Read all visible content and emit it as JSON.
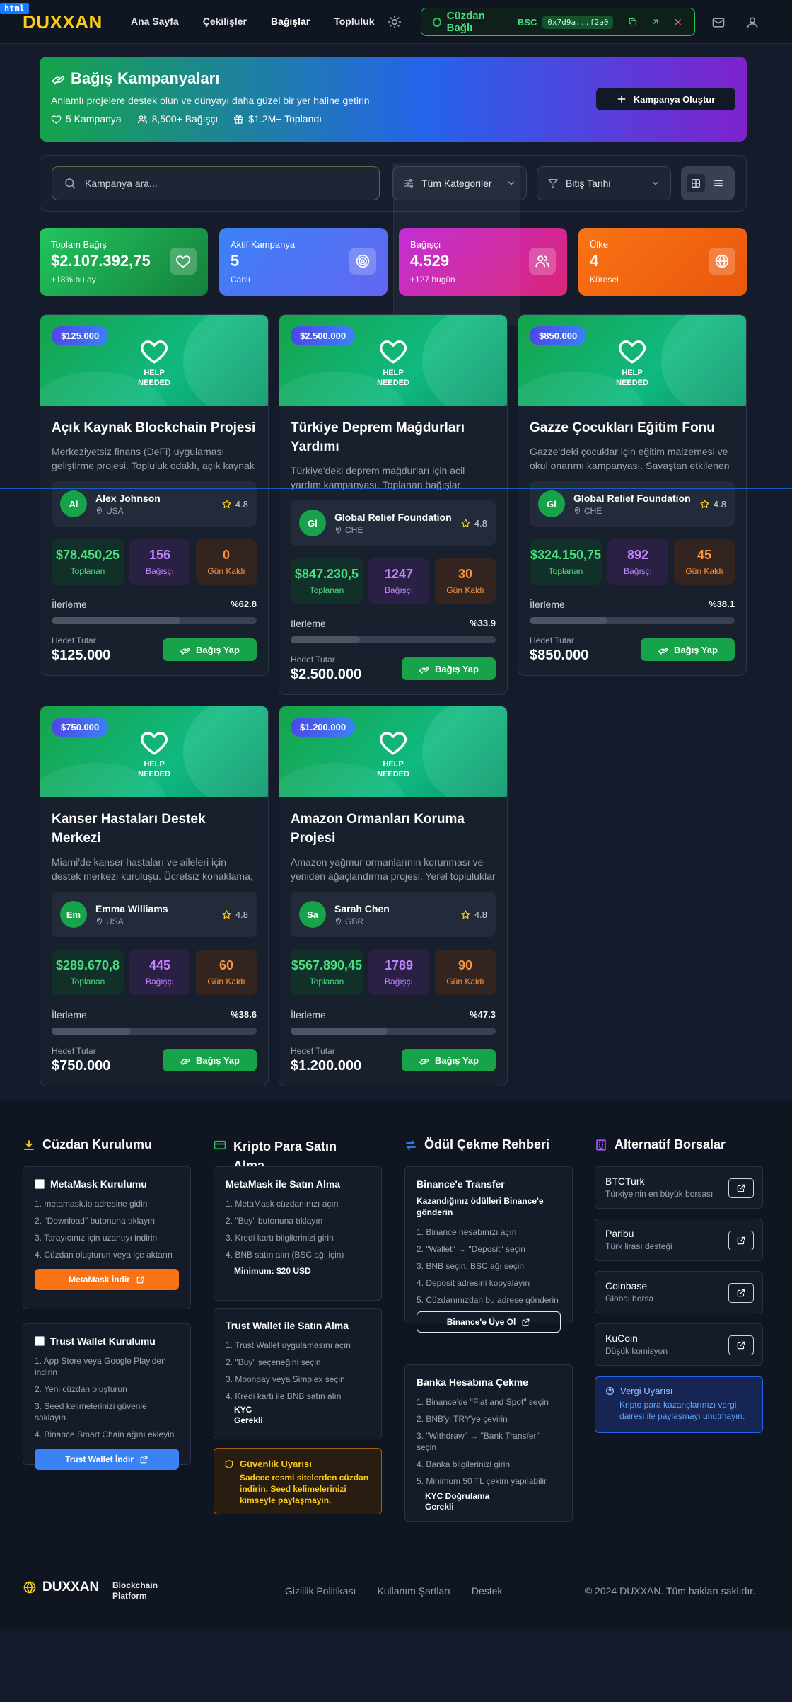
{
  "dev_tag": "html",
  "header": {
    "logo": "DUXXAN",
    "nav": [
      "Ana Sayfa",
      "Çekilişler",
      "Bağışlar",
      "Topluluk"
    ],
    "wallet": {
      "status": "Cüzdan Bağlı",
      "network": "BSC",
      "address": "0x7d9a...f2a0"
    }
  },
  "hero": {
    "title": "Bağış Kampanyaları",
    "subtitle": "Anlamlı projelere destek olun ve dünyayı daha güzel bir yer haline getirin",
    "stats": [
      "5 Kampanya",
      "8,500+ Bağışçı",
      "$1.2M+ Toplandı"
    ],
    "create_label": "Kampanya Oluştur"
  },
  "filters": {
    "search_placeholder": "Kampanya ara...",
    "category": "Tüm Kategoriler",
    "sort": "Bitiş Tarihi"
  },
  "stats": [
    {
      "label": "Toplam Bağış",
      "value": "$2.107.392,75",
      "sub": "+18% bu ay",
      "icon": "heart-icon",
      "color": "#22c55e"
    },
    {
      "label": "Aktif Kampanya",
      "value": "5",
      "sub": "Canlı",
      "icon": "target-icon",
      "color": "#3b82f6"
    },
    {
      "label": "Bağışçı",
      "value": "4.529",
      "sub": "+127 bugün",
      "icon": "users-icon",
      "color": "#c026d3"
    },
    {
      "label": "Ülke",
      "value": "4",
      "sub": "Küresel",
      "icon": "globe-icon",
      "color": "#f97316"
    }
  ],
  "card_labels": {
    "help": "HELP",
    "needed": "NEEDED",
    "raised": "Toplanan",
    "donors": "Bağışçı",
    "days_left": "Gün Kaldı",
    "progress": "İlerleme",
    "goal": "Hedef Tutar",
    "donate": "Bağış Yap"
  },
  "campaigns": [
    {
      "badge": "$125.000",
      "title": "Açık Kaynak Blockchain Projesi",
      "desc": "Merkeziyetsiz finans (DeFi) uygulaması geliştirme projesi. Topluluk odaklı, açık kaynak",
      "org": "Alex Johnson",
      "initials": "Al",
      "country": "USA",
      "rating": "4.8",
      "raised": "$78.450,25",
      "donors": "156",
      "days": "0",
      "progress_text": "%62.8",
      "progress": 0.628,
      "goal": "$125.000"
    },
    {
      "badge": "$2.500.000",
      "title": "Türkiye Deprem Mağdurları Yardımı",
      "desc": "Türkiye'deki deprem mağdurları için acil yardım kampanyası. Toplanan bağışlar",
      "org": "Global Relief Foundation",
      "initials": "Gl",
      "country": "CHE",
      "rating": "4.8",
      "raised": "$847.230,5",
      "donors": "1247",
      "days": "30",
      "progress_text": "%33.9",
      "progress": 0.339,
      "goal": "$2.500.000"
    },
    {
      "badge": "$850.000",
      "title": "Gazze Çocukları Eğitim Fonu",
      "desc": "Gazze'deki çocuklar için eğitim malzemesi ve okul onarımı kampanyası. Savaştan etkilenen",
      "org": "Global Relief Foundation",
      "initials": "Gl",
      "country": "CHE",
      "rating": "4.8",
      "raised": "$324.150,75",
      "donors": "892",
      "days": "45",
      "progress_text": "%38.1",
      "progress": 0.381,
      "goal": "$850.000"
    },
    {
      "badge": "$750.000",
      "title": "Kanser Hastaları Destek Merkezi",
      "desc": "Miami'de kanser hastaları ve aileleri için destek merkezi kuruluşu. Ücretsiz konaklama,",
      "org": "Emma Williams",
      "initials": "Em",
      "country": "USA",
      "rating": "4.8",
      "raised": "$289.670,8",
      "donors": "445",
      "days": "60",
      "progress_text": "%38.6",
      "progress": 0.386,
      "goal": "$750.000"
    },
    {
      "badge": "$1.200.000",
      "title": "Amazon Ormanları Koruma Projesi",
      "desc": "Amazon yağmur ormanlarının korunması ve yeniden ağaçlandırma projesi. Yerel topluluklar",
      "org": "Sarah Chen",
      "initials": "Sa",
      "country": "GBR",
      "rating": "4.8",
      "raised": "$567.890,45",
      "donors": "1789",
      "days": "90",
      "progress_text": "%47.3",
      "progress": 0.473,
      "goal": "$1.200.000"
    }
  ],
  "footer": {
    "wallet_setup": {
      "title": "Cüzdan Kurulumu",
      "metamask": {
        "title": "MetaMask Kurulumu",
        "steps": [
          "1. metamask.io adresine gidin",
          "2. \"Download\" butonuna tıklayın",
          "3. Tarayıcınız için uzantıyı indirin",
          "4. Cüzdan oluşturun veya içe aktarın"
        ],
        "button": "MetaMask İndir"
      },
      "trust": {
        "title": "Trust Wallet Kurulumu",
        "steps": [
          "1. App Store veya Google Play'den indirin",
          "2. Yeni cüzdan oluşturun",
          "3. Seed kelimelerinizi güvenle saklayın",
          "4. Binance Smart Chain ağını ekleyin"
        ],
        "button": "Trust Wallet İndir"
      }
    },
    "buy_crypto": {
      "title1": "Kripto Para Satın",
      "title2": "Alma",
      "metamask": {
        "title": "MetaMask ile Satın Alma",
        "steps": [
          "1. MetaMask cüzdanınızı açın",
          "2. \"Buy\" butonuna tıklayın",
          "3. Kredi kartı bilgilerinizi girin",
          "4. BNB satın alın (BSC ağı için)"
        ],
        "note": "Minimum: $20 USD"
      },
      "trust": {
        "title": "Trust Wallet ile Satın Alma",
        "steps": [
          "1. Trust Wallet uygulamasını açın",
          "2. \"Buy\" seçeneğini seçin",
          "3. Moonpay veya Simplex seçin",
          "4. Kredi kartı ile BNB satın alın"
        ],
        "note1": "KYC",
        "note2": "Gerekli"
      },
      "warning": {
        "title": "Güvenlik Uyarısı",
        "body": "Sadece resmi sitelerden cüzdan indirin. Seed kelimelerinizi kimseyle paylaşmayın."
      }
    },
    "withdraw": {
      "title": "Ödül Çekme Rehberi",
      "binance": {
        "title": "Binance'e Transfer",
        "subtitle": "Kazandığınız ödülleri Binance'e gönderin",
        "steps": [
          "1. Binance hesabınızı açın",
          "2. \"Wallet\" → \"Deposit\" seçin",
          "3. BNB seçin, BSC ağı seçin",
          "4. Deposit adresini kopyalayın",
          "5. Cüzdanınızdan bu adrese gönderin"
        ],
        "button": "Binance'e Üye Ol"
      },
      "bank": {
        "title": "Banka Hesabına Çekme",
        "steps": [
          "1. Binance'de \"Fiat and Spot\" seçin",
          "2. BNB'yi TRY'ye çevirin",
          "3. \"Withdraw\" → \"Bank Transfer\" seçin",
          "4. Banka bilgilerinizi girin",
          "5. Minimum 50 TL çekim yapılabilir"
        ],
        "note1": "KYC Doğrulama",
        "note2": "Gerekli"
      }
    },
    "exchanges": {
      "title": "Alternatif Borsalar",
      "items": [
        {
          "name": "BTCTurk",
          "desc": "Türkiye'nin en büyük borsası"
        },
        {
          "name": "Paribu",
          "desc": "Türk lirası desteği"
        },
        {
          "name": "Coinbase",
          "desc": "Global borsa"
        },
        {
          "name": "KuCoin",
          "desc": "Düşük komisyon"
        }
      ],
      "tax": {
        "title": "Vergi Uyarısı",
        "body": "Kripto para kazançlarınızı vergi dairesi ile paylaşmayı unutmayın."
      }
    },
    "bottom": {
      "logo": "DUXXAN",
      "tag1": "Blockchain",
      "tag2": "Platform",
      "links": [
        "Gizlilik Politikası",
        "Kullanım Şartları",
        "Destek"
      ],
      "copyright": "© 2024 DUXXAN. Tüm hakları saklıdır."
    }
  },
  "colors": {
    "brand": "#facc15",
    "accent_green": "#22c55e",
    "accent_blue": "#3b82f6"
  }
}
